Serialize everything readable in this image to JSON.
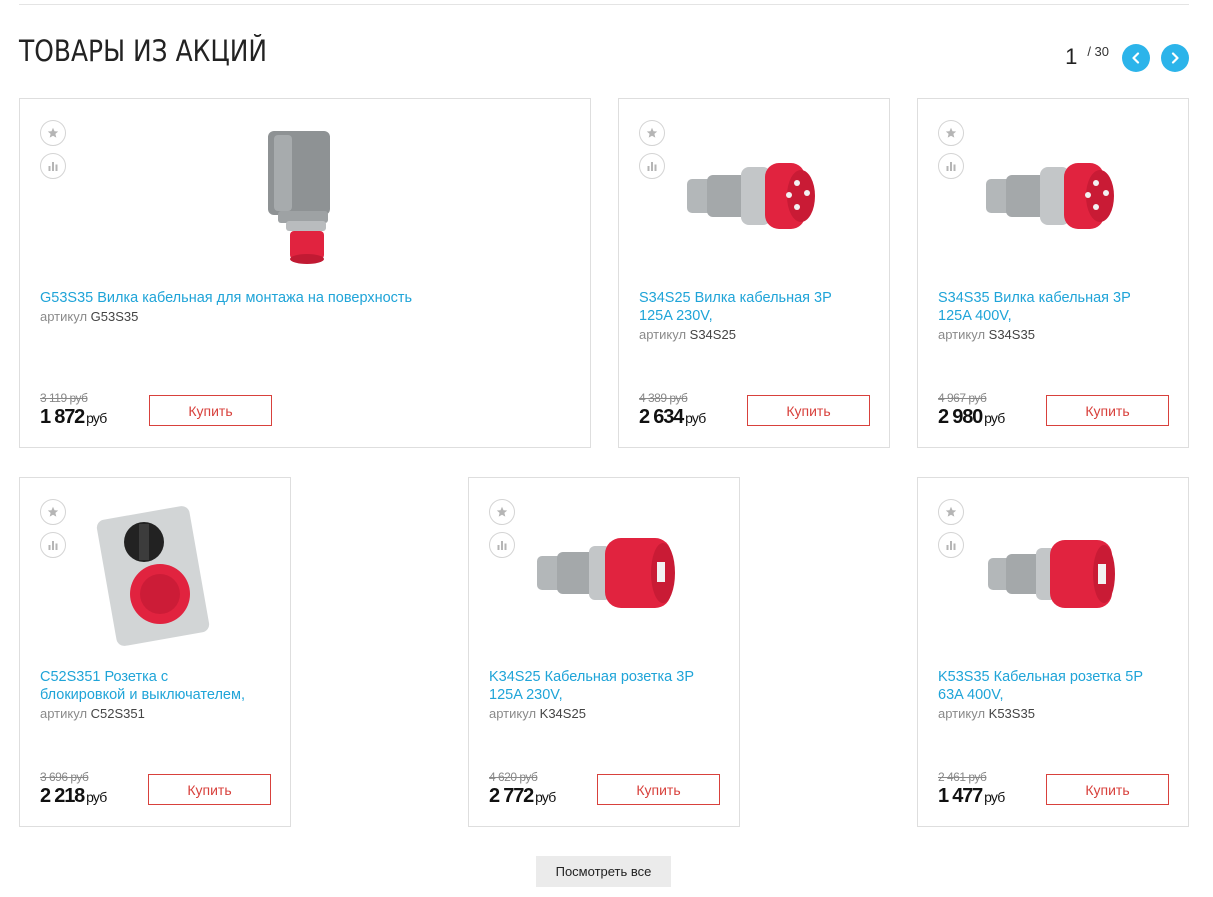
{
  "section": {
    "title": "ТОВАРЫ ИЗ АКЦИЙ",
    "pager": {
      "current": "1",
      "total": "/ 30",
      "prev_icon": "chevron-left-icon",
      "next_icon": "chevron-right-icon",
      "accent": "#2cb4ea"
    }
  },
  "labels": {
    "article": "артикул",
    "buy": "Купить",
    "currency": "руб",
    "view_all": "Посмотреть все"
  },
  "colors": {
    "link": "#1fa4d8",
    "buy_border": "#d8413c",
    "product_red": "#e1233f",
    "product_grey": "#a9adb0"
  },
  "products": [
    {
      "name": "G53S35 Вилка кабельная для монтажа на поверхность",
      "name2": "",
      "article": "G53S35",
      "old_price": "3 119 руб",
      "price": "1 872",
      "image": "wall-plug-icon"
    },
    {
      "name": "S34S25 Вилка кабельная 3P",
      "name2": "125A 230V,",
      "article": "S34S25",
      "old_price": "4 389 руб",
      "price": "2 634",
      "image": "cable-plug-icon"
    },
    {
      "name": "S34S35 Вилка кабельная 3P",
      "name2": "125A 400V,",
      "article": "S34S35",
      "old_price": "4 967 руб",
      "price": "2 980",
      "image": "cable-plug-icon"
    },
    {
      "name": "C52S351 Розетка с",
      "name2": "блокировкой и выключателем,",
      "article": "C52S351",
      "old_price": "3 696 руб",
      "price": "2 218",
      "image": "switched-socket-icon"
    },
    {
      "name": "K34S25 Кабельная розетка 3P",
      "name2": "125A 230V,",
      "article": "K34S25",
      "old_price": "4 620 руб",
      "price": "2 772",
      "image": "cable-socket-icon"
    },
    {
      "name": "K53S35 Кабельная розетка 5P",
      "name2": "63A 400V,",
      "article": "K53S35",
      "old_price": "2 461 руб",
      "price": "1 477",
      "image": "cable-socket-icon"
    }
  ]
}
